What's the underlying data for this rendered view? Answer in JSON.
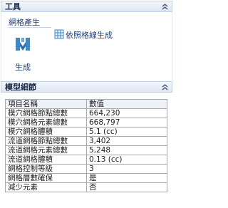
{
  "tools_panel": {
    "title": "工具",
    "group_label": "網格產生",
    "generate_button_label": "生成",
    "mesh_by_grid_label": "依照格線生成",
    "icons": {
      "collapse": "chevron-double-up-icon",
      "generate": "mesh-generate-icon",
      "mesh_by_grid": "grid-mesh-icon"
    }
  },
  "model_panel": {
    "title": "模型細節",
    "columns": [
      "項目名稱",
      "數值"
    ],
    "rows": [
      {
        "name": "模穴網格節點總數",
        "value": "664,230"
      },
      {
        "name": "模穴網格元素總數",
        "value": "668,797"
      },
      {
        "name": "模穴網格體積",
        "value": "5.1 (cc)"
      },
      {
        "name": "流道網格節點總數",
        "value": "3,402"
      },
      {
        "name": "流道網格元素總數",
        "value": "5,248"
      },
      {
        "name": "流道網格體積",
        "value": "0.13 (cc)"
      },
      {
        "name": "網格控制等級",
        "value": "3"
      },
      {
        "name": "網格層數確保",
        "value": "是"
      },
      {
        "name": "減少元素",
        "value": "否"
      }
    ]
  },
  "colors": {
    "header_bg": "#dde6f3",
    "accent": "#1f3d7a",
    "icon_blue": "#3f87c9"
  }
}
